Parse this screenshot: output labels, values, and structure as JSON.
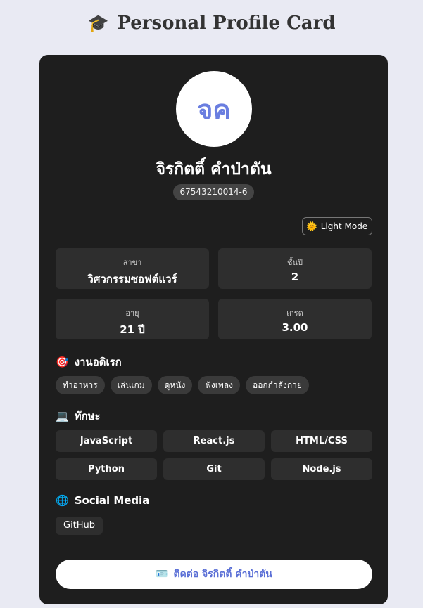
{
  "header": {
    "icon": "graduation-cap-icon",
    "icon_glyph": "🎓",
    "title": "Personal Profile Card"
  },
  "profile": {
    "avatar_initials": "จค",
    "name": "จิรกิตติ์ คำป่าตัน",
    "student_id": "67543210014-6"
  },
  "theme_toggle": {
    "icon": "sun-icon",
    "icon_glyph": "🌞",
    "label": "Light Mode"
  },
  "info": [
    {
      "label": "สาขา",
      "value": "วิศวกรรมซอฟต์แวร์"
    },
    {
      "label": "ชั้นปี",
      "value": "2"
    },
    {
      "label": "อายุ",
      "value": "21 ปี"
    },
    {
      "label": "เกรด",
      "value": "3.00"
    }
  ],
  "hobbies": {
    "icon": "target-icon",
    "icon_glyph": "🎯",
    "title": "งานอดิเรก",
    "items": [
      "ทำอาหาร",
      "เล่นเกม",
      "ดูหนัง",
      "ฟังเพลง",
      "ออกกำลังกาย"
    ]
  },
  "skills": {
    "icon": "laptop-icon",
    "icon_glyph": "💻",
    "title": "ทักษะ",
    "items": [
      "JavaScript",
      "React.js",
      "HTML/CSS",
      "Python",
      "Git",
      "Node.js"
    ]
  },
  "social": {
    "icon": "globe-icon",
    "icon_glyph": "🌐",
    "title": "Social Media",
    "items": [
      "GitHub"
    ]
  },
  "contact": {
    "icon": "id-card-icon",
    "icon_glyph": "🪪",
    "label": "ติดต่อ จิรกิตติ์ คำป่าตัน"
  },
  "colors": {
    "page_bg": "#e9eaf3",
    "card_bg": "#1e1e1e",
    "accent": "#6a7ee0"
  }
}
